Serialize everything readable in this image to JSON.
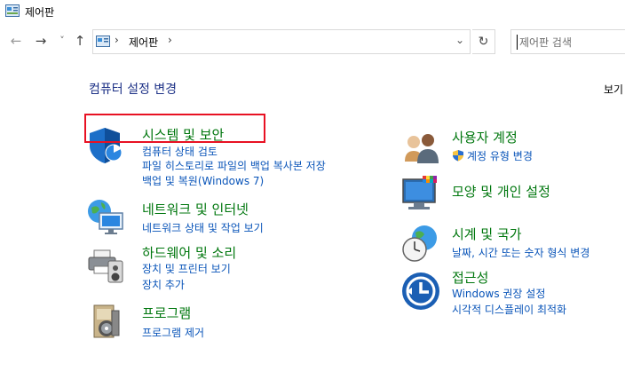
{
  "window": {
    "title": "제어판"
  },
  "nav": {
    "back_glyph": "←",
    "forward_glyph": "→",
    "recent_glyph": "˅",
    "up_glyph": "↑",
    "breadcrumb": [
      "제어판"
    ],
    "separator": "›",
    "dropdown_glyph": "⌄",
    "refresh_glyph": "↻",
    "search_placeholder": "제어판 검색"
  },
  "main": {
    "heading": "컴퓨터 설정 변경",
    "view_by": "보기"
  },
  "categories": {
    "security": {
      "title": "시스템 및 보안",
      "links": [
        "컴퓨터 상태 검토",
        "파일 히스토리로 파일의 백업 복사본 저장",
        "백업 및 복원(Windows 7)"
      ]
    },
    "network": {
      "title": "네트워크 및 인터넷",
      "links": [
        "네트워크 상태 및 작업 보기"
      ]
    },
    "hardware": {
      "title": "하드웨어 및 소리",
      "links": [
        "장치 및 프린터 보기",
        "장치 추가"
      ]
    },
    "programs": {
      "title": "프로그램",
      "links": [
        "프로그램 제거"
      ]
    },
    "accounts": {
      "title": "사용자 계정",
      "links": [
        "계정 유형 변경"
      ]
    },
    "appearance": {
      "title": "모양 및 개인 설정",
      "links": []
    },
    "clock": {
      "title": "시계 및 국가",
      "links": [
        "날짜, 시간 또는 숫자 형식 변경"
      ]
    },
    "ease": {
      "title": "접근성",
      "links": [
        "Windows 권장 설정",
        "시각적 디스플레이 최적화"
      ]
    }
  },
  "colors": {
    "category_title": "#00770e",
    "link": "#0a55b9",
    "heading": "#1e3287",
    "highlight": "#e81123"
  }
}
